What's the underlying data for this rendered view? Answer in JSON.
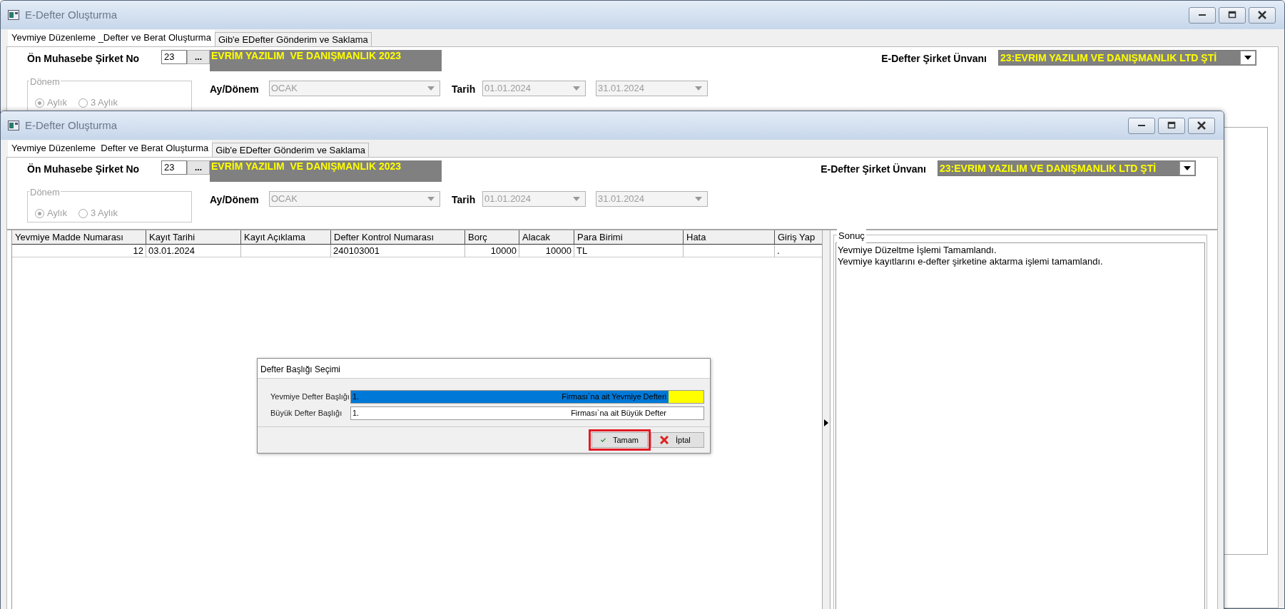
{
  "background_window": {
    "title": "E-Defter Oluşturma",
    "tabs": [
      {
        "label": "Yevmiye Düzenleme _Defter ve Berat Oluşturma",
        "selected": true
      },
      {
        "label": "Gib'e EDefter Gönderim ve Saklama",
        "selected": false
      }
    ],
    "form": {
      "company_no_label": "Ön Muhasebe Şirket No",
      "company_no": "23",
      "browse_button": "...",
      "company_name": "EVRİM YAZILIM  VE DANIŞMANLIK 2023",
      "edefter_label": "E-Defter Şirket Ünvanı",
      "edefter_company": "23:EVRIM YAZILIM VE DANIŞMANLIK LTD ŞTİ",
      "period_group": {
        "title": "Dönem",
        "disabled": true,
        "options": [
          {
            "label": "Aylık",
            "selected": true
          },
          {
            "label": "3 Aylık",
            "selected": false
          }
        ]
      },
      "month_label": "Ay/Dönem",
      "month": {
        "value": "OCAK",
        "disabled": true
      },
      "date_label": "Tarih",
      "date_from": {
        "value": "01.01.2024",
        "disabled": true
      },
      "date_to": {
        "value": "31.01.2024",
        "disabled": true
      }
    }
  },
  "front_window": {
    "title": "E-Defter Oluşturma",
    "tabs": [
      {
        "label": "Yevmiye Düzenleme  Defter ve Berat Oluşturma",
        "selected": true
      },
      {
        "label": "Gib'e EDefter Gönderim ve Saklama",
        "selected": false
      }
    ],
    "form": {
      "company_no_label": "Ön Muhasebe Şirket No",
      "company_no": "23",
      "browse_button": "...",
      "company_name": "EVRİM YAZILIM  VE DANIŞMANLIK 2023",
      "edefter_label": "E-Defter Şirket Ünvanı",
      "edefter_company": "23:EVRIM YAZILIM VE DANIŞMANLIK LTD ŞTİ",
      "period_group": {
        "title": "Dönem",
        "disabled": true,
        "options": [
          {
            "label": "Aylık",
            "selected": true
          },
          {
            "label": "3 Aylık",
            "selected": false
          }
        ]
      },
      "month_label": "Ay/Dönem",
      "month": {
        "value": "OCAK",
        "disabled": true
      },
      "date_label": "Tarih",
      "date_from": {
        "value": "01.01.2024",
        "disabled": true
      },
      "date_to": {
        "value": "31.01.2024",
        "disabled": true
      }
    },
    "grid": {
      "columns": [
        "Yevmiye Madde Numarası",
        "Kayıt Tarihi",
        "Kayıt Açıklama",
        "Defter Kontrol Numarası",
        "Borç",
        "Alacak",
        "Para Birimi",
        "Hata",
        "Giriş Yap"
      ],
      "rows": [
        [
          "12",
          "03.01.2024",
          null,
          "240103001",
          "10000",
          "10000",
          "TL",
          null,
          "."
        ]
      ]
    },
    "result_panel": {
      "title": "Sonuç",
      "lines": [
        "Yevmiye Düzeltme İşlemi Tamamlandı.",
        "Yevmiye kayıtlarını e-defter şirketine aktarma işlemi tamamlandı."
      ]
    }
  },
  "dialog": {
    "title": "Defter Başlığı Seçimi",
    "fields": [
      {
        "label": "Yevmiye Defter Başlığı",
        "value_start": "1.",
        "value_end": "Firması`na ait Yevmiye Defteri",
        "selected": true
      },
      {
        "label": "Büyük Defter Başlığı",
        "value_start": "1.",
        "value_end": "Firması`na ait Büyük Defter",
        "selected": false
      }
    ],
    "buttons": [
      {
        "kind": "ok",
        "label": "Tamam",
        "highlighted": true
      },
      {
        "kind": "cancel",
        "label": "İptal",
        "highlighted": false
      }
    ]
  }
}
